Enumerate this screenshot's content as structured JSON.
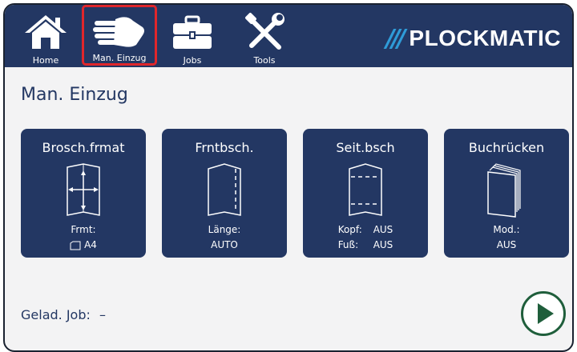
{
  "nav": {
    "home_label": "Home",
    "man_label": "Man. Einzug",
    "jobs_label": "Jobs",
    "tools_label": "Tools"
  },
  "brand": {
    "slashes": "///",
    "name": "PLOCKMATIC"
  },
  "page_title": "Man. Einzug",
  "cards": [
    {
      "title": "Brosch.frmat",
      "line1": "Frmt:",
      "line2": "A4",
      "icon": "booklet-format-icon"
    },
    {
      "title": "Frntbsch.",
      "line1": "Länge:",
      "line2": "AUTO",
      "icon": "front-trim-icon"
    },
    {
      "title": "Seit.bsch",
      "line1_key": "Kopf:",
      "line1_val": "AUS",
      "line2_key": "Fuß:",
      "line2_val": "AUS",
      "icon": "side-trim-icon"
    },
    {
      "title": "Buchrücken",
      "line1": "Mod.:",
      "line2": "AUS",
      "icon": "spine-icon"
    }
  ],
  "status": {
    "label": "Gelad. Job:",
    "value": "–"
  },
  "colors": {
    "navy": "#233763",
    "accent_red": "#e0262b",
    "brand_blue": "#2f9bd8",
    "play_green": "#1f5e3b"
  }
}
